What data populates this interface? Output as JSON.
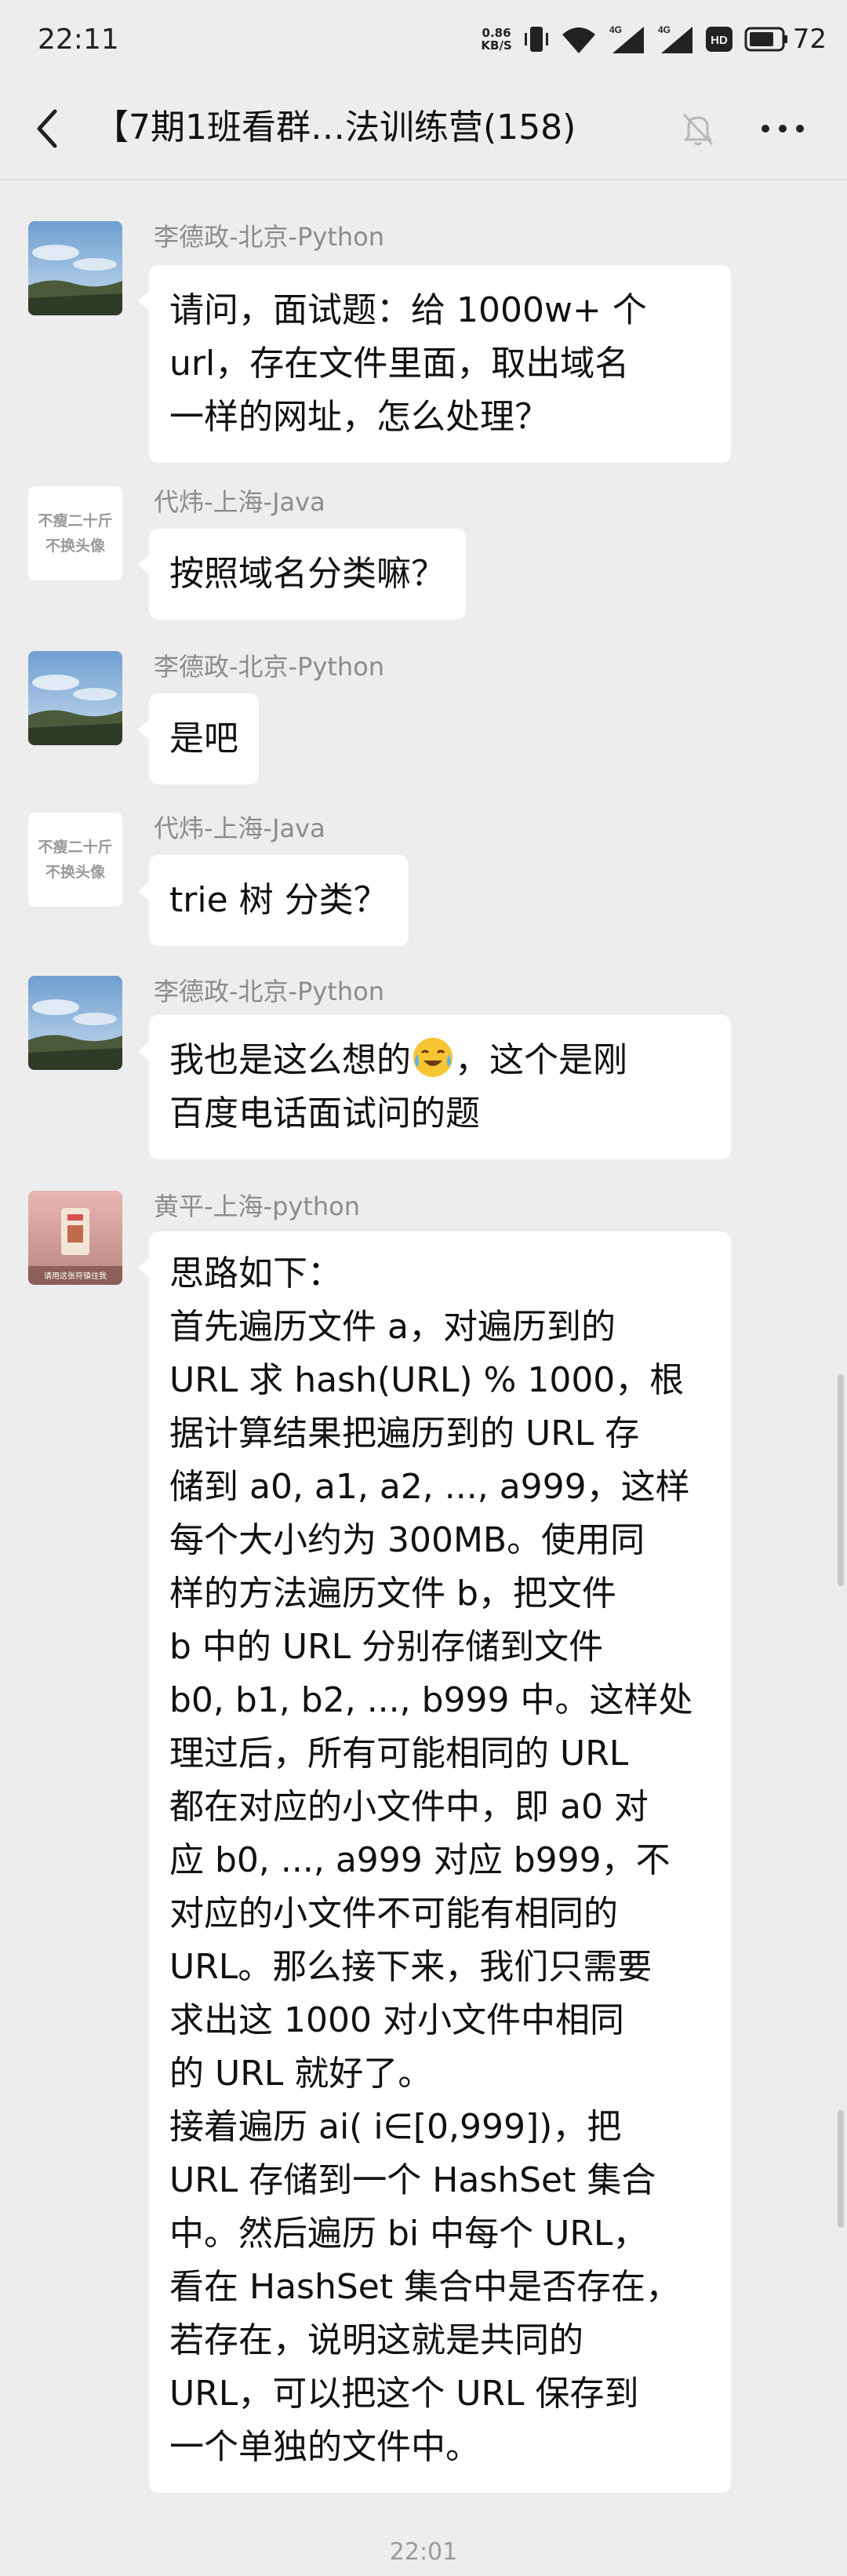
{
  "status_bar": {
    "time": "22:11",
    "net_speed_value": "0.86",
    "net_speed_unit": "KB/S",
    "network_type_1": "4G",
    "network_type_2": "4G",
    "hd_badge": "HD",
    "battery": "72"
  },
  "header": {
    "title": "【7期1班看群…法训练营(158)",
    "icons": [
      "back-icon",
      "mute-icon",
      "more-icon"
    ]
  },
  "messages": [
    {
      "sender": "李德政-北京-Python",
      "avatar": "landscape-photo",
      "text": "请问，面试题：给 1000w+ 个\nurl，存在文件里面，取出域名\n一样的网址，怎么处理？"
    },
    {
      "sender": "代炜-上海-Java",
      "avatar_text_1": "不瘦二十斤",
      "avatar_text_2": "不换头像",
      "text": "按照域名分类嘛？"
    },
    {
      "sender": "李德政-北京-Python",
      "avatar": "landscape-photo",
      "text": "是吧"
    },
    {
      "sender": "代炜-上海-Java",
      "avatar_text_1": "不瘦二十斤",
      "avatar_text_2": "不换头像",
      "text": "trie 树 分类？"
    },
    {
      "sender": "李德政-北京-Python",
      "avatar": "landscape-photo",
      "text_before_emoji": "我也是这么想的",
      "emoji": "crying-laughing-emoji",
      "text_after_emoji": "，这个是刚\n百度电话面试问的题"
    },
    {
      "sender": "黄平-上海-python",
      "avatar_caption": "请用这张符镇住我",
      "text": "思路如下：\n首先遍历文件 a，对遍历到的\nURL 求 hash(URL) % 1000，根\n据计算结果把遍历到的 URL 存\n储到 a0, a1, a2, ..., a999，这样\n每个大小约为 300MB。使用同\n样的方法遍历文件 b，把文件\nb 中的 URL 分别存储到文件\nb0, b1, b2, ..., b999 中。这样处\n理过后，所有可能相同的 URL\n都在对应的小文件中，即 a0 对\n应 b0, ..., a999 对应 b999，不\n对应的小文件不可能有相同的\nURL。那么接下来，我们只需要\n求出这 1000 对小文件中相同\n的 URL 就好了。\n接着遍历 ai( i∈[0,999])，把\nURL 存储到一个 HashSet  集合\n中。然后遍历 bi 中每个 URL，\n看在 HashSet 集合中是否存在，\n若存在，说明这就是共同的\nURL，可以把这个 URL 保存到\n一个单独的文件中。"
    }
  ],
  "timestamp": "22:01",
  "colors": {
    "background": "#ededed",
    "bubble": "#ffffff",
    "sender_name": "#8c8c8c"
  }
}
